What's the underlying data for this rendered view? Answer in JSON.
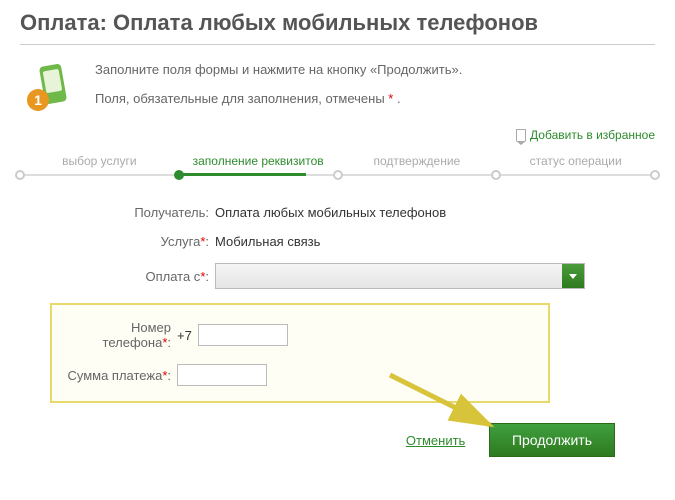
{
  "title": "Оплата: Оплата любых мобильных телефонов",
  "instructions": {
    "line1": "Заполните поля формы и нажмите на кнопку «Продолжить».",
    "line2_pre": "Поля, обязательные для заполнения, отмечены ",
    "line2_post": " ."
  },
  "favorite": {
    "label": "Добавить в избранное"
  },
  "steps": {
    "s1": "выбор услуги",
    "s2": "заполнение реквизитов",
    "s3": "подтверждение",
    "s4": "статус операции"
  },
  "form": {
    "recipient_label": "Получатель:",
    "recipient_value": "Оплата любых мобильных телефонов",
    "service_label": "Услуга",
    "service_value": "Мобильная связь",
    "payfrom_label": "Оплата с",
    "phone_label": "Номер телефона",
    "phone_prefix": "+7",
    "amount_label": "Сумма платежа"
  },
  "actions": {
    "cancel": "Отменить",
    "continue": "Продолжить"
  },
  "asterisk": "*",
  "colon": ":"
}
